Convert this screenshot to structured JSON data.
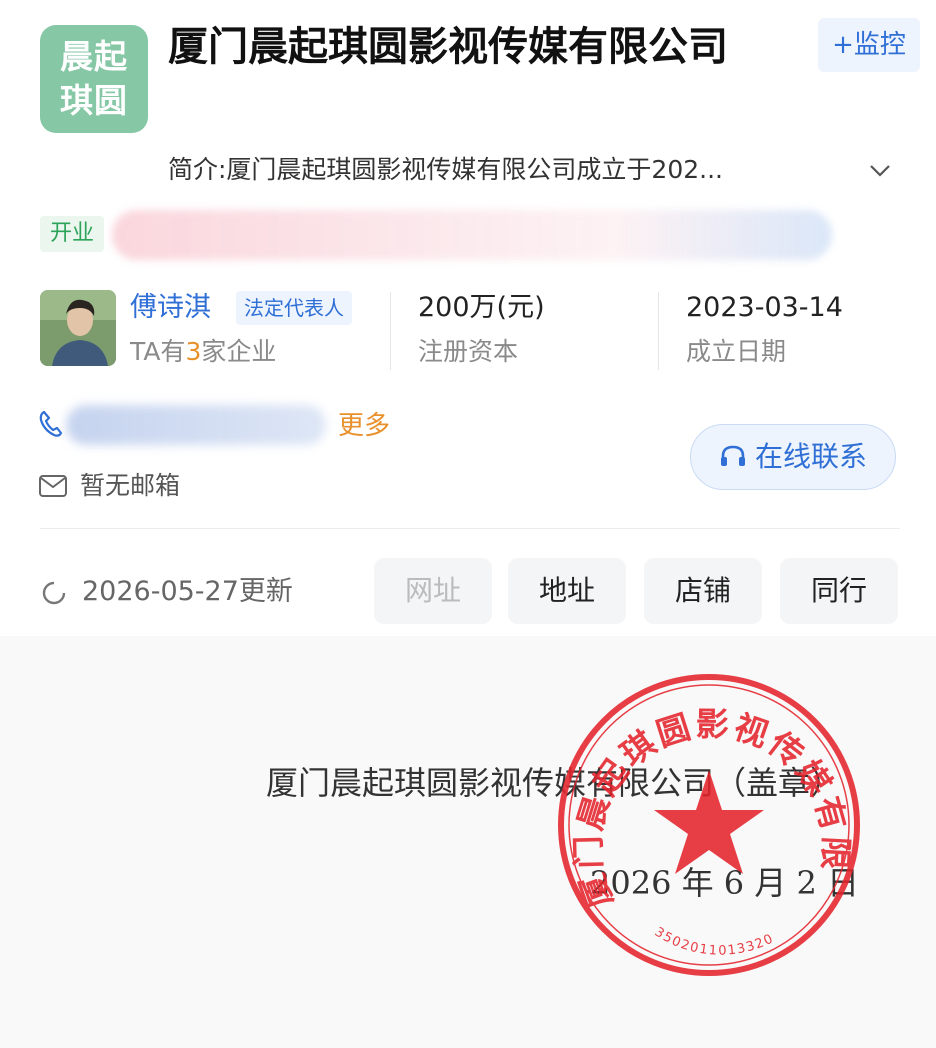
{
  "company": {
    "logo_lines": [
      "晨起",
      "琪圆"
    ],
    "name": "厦门晨起琪圆影视传媒有限公司",
    "monitor_label": "+监控",
    "intro": "简介:厦门晨起琪圆影视传媒有限公司成立于202...",
    "status_tag": "开业"
  },
  "legal_rep": {
    "name": "傅诗淇",
    "badge": "法定代表人",
    "companies_prefix": "TA有",
    "companies_count": "3",
    "companies_suffix": "家企业"
  },
  "stats": {
    "capital_value": "200万(元)",
    "capital_label": "注册资本",
    "founded_value": "2023-03-14",
    "founded_label": "成立日期"
  },
  "contact": {
    "more_label": "更多",
    "email_text": "暂无邮箱",
    "online_label": "在线联系"
  },
  "update": {
    "updated_text": "2026-05-27更新",
    "buttons": [
      "网址",
      "地址",
      "店铺",
      "同行"
    ]
  },
  "document": {
    "company_line": "厦门晨起琪圆影视传媒有限公司（盖章）",
    "date_line": "2026 年 6 月 2 日",
    "seal_text": "厦门晨起琪圆影视传媒有限公司",
    "seal_number": "3502011013320"
  },
  "colors": {
    "brand_blue": "#2f6fd6",
    "logo_green": "#86c7a6",
    "accent_orange": "#e8912c",
    "seal_red": "#e5252e"
  }
}
